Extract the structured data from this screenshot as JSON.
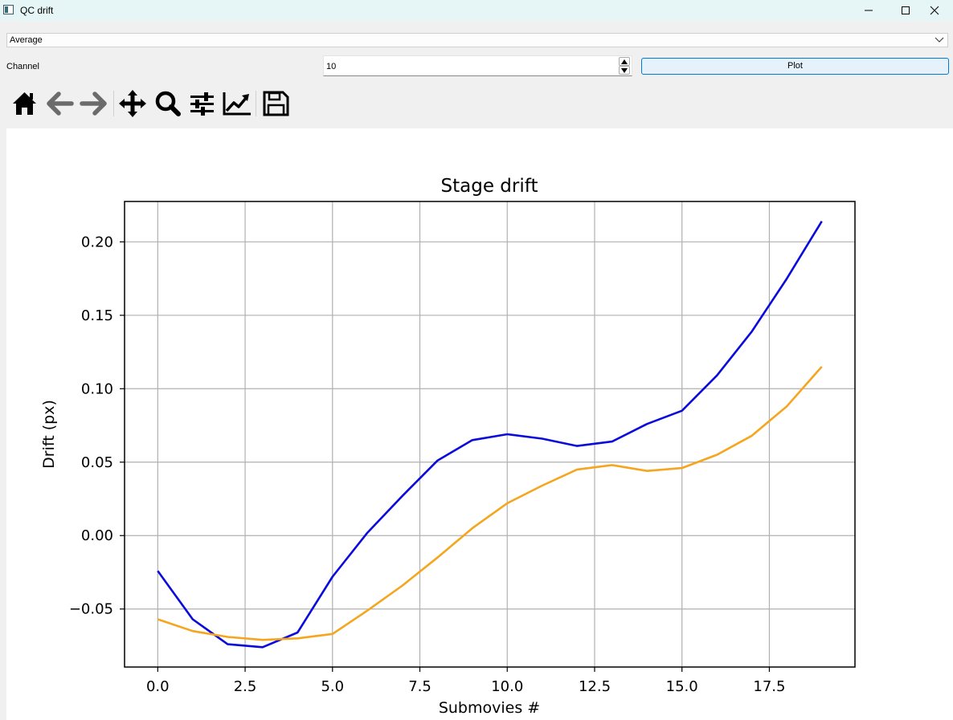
{
  "window": {
    "title": "QC drift",
    "app_icon": "app-window-icon"
  },
  "controls": {
    "mode_select": {
      "value": "Average",
      "icon": "chevron-down-icon"
    },
    "channel_label": "Channel",
    "channel_value": "10",
    "plot_label": "Plot"
  },
  "toolbar": {
    "items": [
      "home-icon",
      "back-arrow-icon",
      "forward-arrow-icon",
      "pan-move-icon",
      "zoom-magnifier-icon",
      "configure-subplots-icon",
      "edit-axis-curves-icon",
      "save-floppy-icon"
    ]
  },
  "colors": {
    "series_1": "#0a0adc",
    "series_2": "#f5a51e",
    "grid": "#b0b0b0",
    "accent": "#0078d7"
  },
  "chart_data": {
    "type": "line",
    "title": "Stage drift",
    "xlabel": "Submovies #",
    "ylabel": "Drift (px)",
    "xlim": [
      -0.95,
      19.95
    ],
    "ylim": [
      -0.0895,
      0.2275
    ],
    "xticks": [
      0,
      2.5,
      5,
      7.5,
      10,
      12.5,
      15,
      17.5
    ],
    "xtick_labels": [
      "0.0",
      "2.5",
      "5.0",
      "7.5",
      "10.0",
      "12.5",
      "15.0",
      "17.5"
    ],
    "yticks": [
      -0.05,
      0,
      0.05,
      0.1,
      0.15,
      0.2
    ],
    "ytick_labels": [
      "−0.05",
      "0.00",
      "0.05",
      "0.10",
      "0.15",
      "0.20"
    ],
    "grid": true,
    "legend": "none",
    "x": [
      0,
      1,
      2,
      3,
      4,
      5,
      6,
      7,
      8,
      9,
      10,
      11,
      12,
      13,
      14,
      15,
      16,
      17,
      18,
      19
    ],
    "series": [
      {
        "color": "#0a0adc",
        "values": [
          -0.024,
          -0.057,
          -0.074,
          -0.076,
          -0.066,
          -0.028,
          0.002,
          0.027,
          0.051,
          0.065,
          0.069,
          0.066,
          0.061,
          0.064,
          0.076,
          0.085,
          0.109,
          0.139,
          0.175,
          0.214
        ]
      },
      {
        "color": "#f5a51e",
        "values": [
          -0.057,
          -0.065,
          -0.069,
          -0.071,
          -0.07,
          -0.067,
          -0.051,
          -0.034,
          -0.015,
          0.005,
          0.022,
          0.034,
          0.045,
          0.048,
          0.044,
          0.046,
          0.055,
          0.068,
          0.088,
          0.115
        ]
      }
    ]
  }
}
